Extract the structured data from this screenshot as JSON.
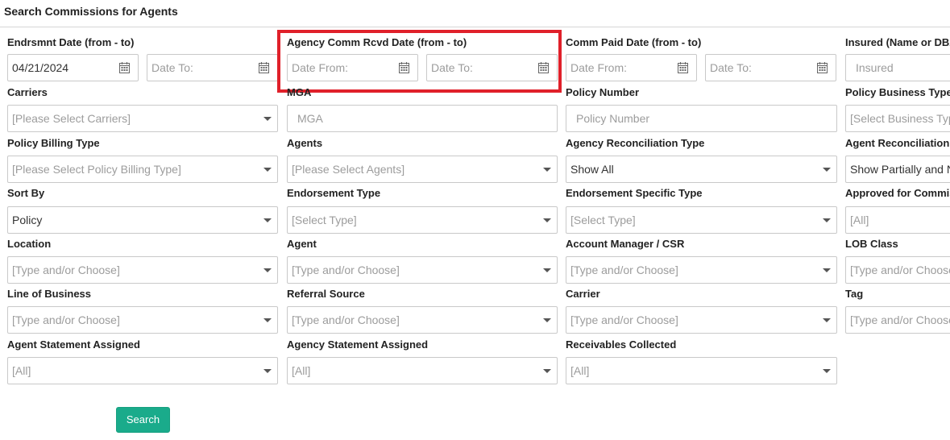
{
  "page": {
    "title": "Search Commissions for Agents"
  },
  "fields": {
    "endorsement_date": {
      "label": "Endrsmnt Date (from - to)",
      "from_value": "04/21/2024",
      "to_placeholder": "Date To:"
    },
    "agency_comm_rcvd_date": {
      "label": "Agency Comm Rcvd Date (from - to)",
      "from_placeholder": "Date From:",
      "to_placeholder": "Date To:"
    },
    "comm_paid_date": {
      "label": "Comm Paid Date (from - to)",
      "from_placeholder": "Date From:",
      "to_placeholder": "Date To:"
    },
    "insured": {
      "label": "Insured (Name or DBA)",
      "placeholder": "Insured"
    },
    "carriers": {
      "label": "Carriers",
      "value": "[Please Select Carriers]"
    },
    "mga": {
      "label": "MGA",
      "placeholder": "MGA"
    },
    "policy_number": {
      "label": "Policy Number",
      "placeholder": "Policy Number"
    },
    "policy_business_type": {
      "label": "Policy Business Type",
      "value": "[Select Business Type]"
    },
    "policy_billing_type": {
      "label": "Policy Billing Type",
      "value": "[Please Select Policy Billing Type]"
    },
    "agents": {
      "label": "Agents",
      "value": "[Please Select Agents]"
    },
    "agency_reconciliation_type": {
      "label": "Agency Reconciliation Type",
      "value": "Show All"
    },
    "agent_reconciliation_type": {
      "label": "Agent Reconciliation Type",
      "value": "Show Partially and Not Reconciled"
    },
    "sort_by": {
      "label": "Sort By",
      "value": "Policy"
    },
    "endorsement_type": {
      "label": "Endorsement Type",
      "value": "[Select Type]"
    },
    "endorsement_specific_type": {
      "label": "Endorsement Specific Type",
      "value": "[Select Type]"
    },
    "approved_for_commission": {
      "label": "Approved for Commission",
      "value": "[All]"
    },
    "location": {
      "label": "Location",
      "value": "[Type and/or Choose]"
    },
    "agent": {
      "label": "Agent",
      "value": "[Type and/or Choose]"
    },
    "account_manager_csr": {
      "label": "Account Manager / CSR",
      "value": "[Type and/or Choose]"
    },
    "lob_class": {
      "label": "LOB Class",
      "value": "[Type and/or Choose]"
    },
    "line_of_business": {
      "label": "Line of Business",
      "value": "[Type and/or Choose]"
    },
    "referral_source": {
      "label": "Referral Source",
      "value": "[Type and/or Choose]"
    },
    "carrier": {
      "label": "Carrier",
      "value": "[Type and/or Choose]"
    },
    "tag": {
      "label": "Tag",
      "value": "[Type and/or Choose]"
    },
    "agent_statement_assigned": {
      "label": "Agent Statement Assigned",
      "value": "[All]"
    },
    "agency_statement_assigned": {
      "label": "Agency Statement Assigned",
      "value": "[All]"
    },
    "receivables_collected": {
      "label": "Receivables Collected",
      "value": "[All]"
    }
  },
  "actions": {
    "search_label": "Search"
  },
  "colors": {
    "accent": "#1aab8b",
    "highlight": "#e0202a"
  }
}
